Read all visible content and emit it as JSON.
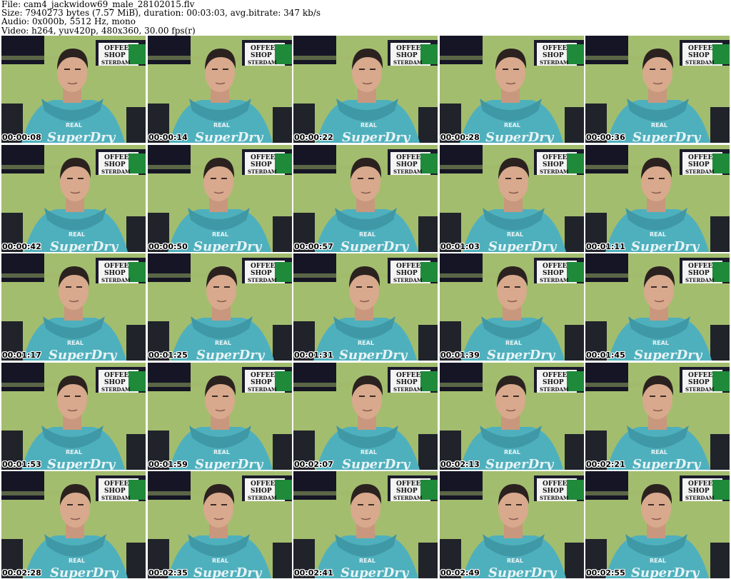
{
  "header": {
    "line1": "File: cam4_jackwidow69_male_28102015.flv",
    "line2": "Size: 7940273 bytes (7.57 MiB), duration: 00:03:03, avg.bitrate: 347 kb/s",
    "line3": "Audio: 0x000b, 5512 Hz, mono",
    "line4": "Video: h264, yuv420p, 480x360, 30.00 fps(r)"
  },
  "sign": {
    "line1": "OFFEE",
    "line2": "SHOP",
    "line3": "STERDAM"
  },
  "hoodie": {
    "top": "REAL",
    "main": "SuperDry"
  },
  "colors": {
    "wall": "#a3bd6e",
    "hoodie": "#4fb0bd",
    "sign_green": "#1f8a3a",
    "poster_dark": "#151525"
  },
  "thumbnails": [
    {
      "timestamp": "00:00:08"
    },
    {
      "timestamp": "00:00:14"
    },
    {
      "timestamp": "00:00:22"
    },
    {
      "timestamp": "00:00:28"
    },
    {
      "timestamp": "00:00:36"
    },
    {
      "timestamp": "00:00:42"
    },
    {
      "timestamp": "00:00:50"
    },
    {
      "timestamp": "00:00:57"
    },
    {
      "timestamp": "00:01:03"
    },
    {
      "timestamp": "00:01:11"
    },
    {
      "timestamp": "00:01:17"
    },
    {
      "timestamp": "00:01:25"
    },
    {
      "timestamp": "00:01:31"
    },
    {
      "timestamp": "00:01:39"
    },
    {
      "timestamp": "00:01:45"
    },
    {
      "timestamp": "00:01:53"
    },
    {
      "timestamp": "00:01:59"
    },
    {
      "timestamp": "00:02:07"
    },
    {
      "timestamp": "00:02:13"
    },
    {
      "timestamp": "00:02:21"
    },
    {
      "timestamp": "00:02:28"
    },
    {
      "timestamp": "00:02:35"
    },
    {
      "timestamp": "00:02:41"
    },
    {
      "timestamp": "00:02:49"
    },
    {
      "timestamp": "00:02:55"
    }
  ]
}
